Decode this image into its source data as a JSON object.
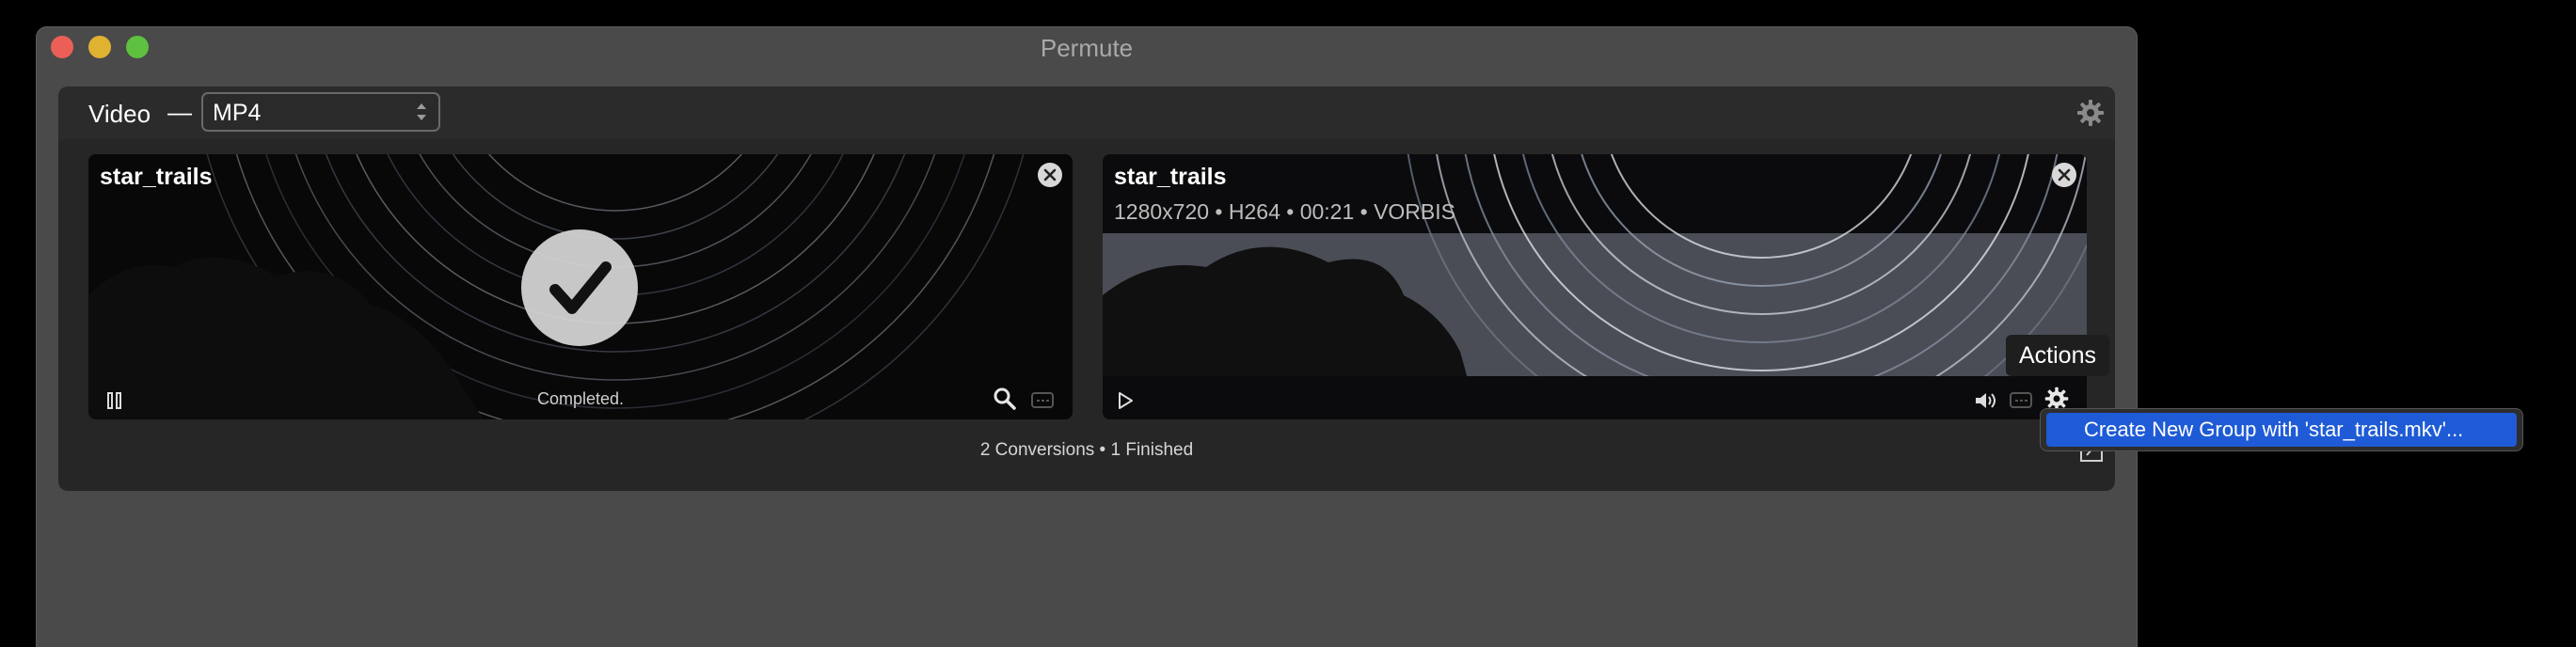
{
  "window": {
    "title": "Permute"
  },
  "toolbar": {
    "type_label": "Video",
    "separator": "—",
    "format_value": "MP4"
  },
  "cards": [
    {
      "title": "star_trails",
      "status": "Completed."
    },
    {
      "title": "star_trails",
      "meta": "1280x720 • H264 • 00:21 • VORBIS"
    }
  ],
  "footer": {
    "summary": "2 Conversions • 1 Finished"
  },
  "tooltip": {
    "text": "Actions"
  },
  "menu": {
    "item": "Create New Group with 'star_trails.mkv'..."
  },
  "colors": {
    "menu_highlight": "#1f5bd6",
    "close_button": "#ec5f57",
    "minimize_button": "#e0b232",
    "maximize_button": "#5ec13f"
  },
  "icons": [
    "gear-icon",
    "close-icon",
    "checkmark-icon",
    "pause-icon",
    "play-icon",
    "search-icon",
    "subtitles-icon",
    "volume-icon",
    "export-icon"
  ]
}
